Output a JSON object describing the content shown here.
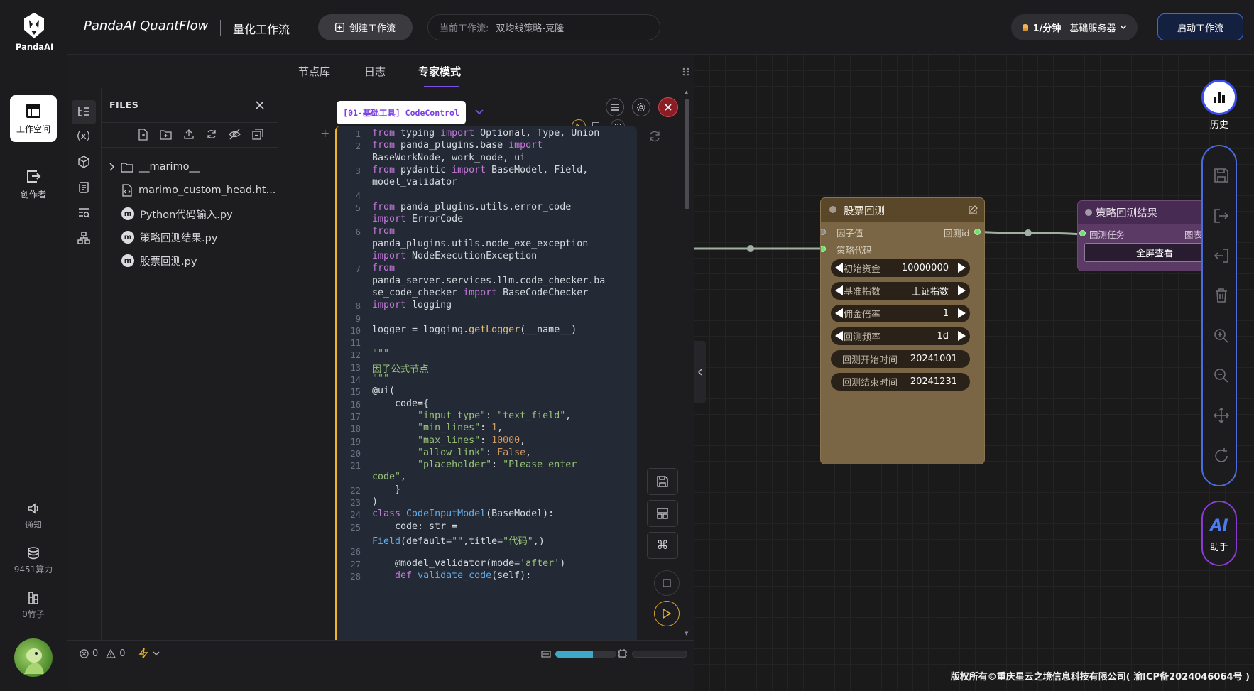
{
  "nav": {
    "logo_text": "PandaAI",
    "workspace": "工作空间",
    "creator": "创作者",
    "notify": "通知",
    "compute": "9451算力",
    "bamboo": "0竹子"
  },
  "top": {
    "app_title": "PandaAI QuantFlow",
    "subtitle": "量化工作流",
    "create_btn": "创建工作流",
    "current_label": "当前工作流:",
    "current_value": "双均线策略-克隆",
    "server_rate": "1/分钟",
    "server_name": "基础服务器",
    "start_btn": "启动工作流"
  },
  "tabs": [
    "节点库",
    "日志",
    "专家模式"
  ],
  "files": {
    "title": "FILES",
    "items": [
      "__marimo__",
      "marimo_custom_head.ht...",
      "Python代码输入.py",
      "策略回测结果.py",
      "股票回测.py"
    ]
  },
  "cell_tag": "[01-基础工具] CodeControl",
  "code": [
    {
      "n": "1",
      "h": "<span class='kw'>from</span> typing <span class='kw'>import</span> Optional, Type, Union"
    },
    {
      "n": "2",
      "h": "<span class='kw'>from</span> panda_plugins.base <span class='kw'>import</span>"
    },
    {
      "n": "",
      "h": "BaseWorkNode, work_node, ui"
    },
    {
      "n": "3",
      "h": "<span class='kw'>from</span> pydantic <span class='kw'>import</span> BaseModel, Field,"
    },
    {
      "n": "",
      "h": "model_validator"
    },
    {
      "n": "4",
      "h": ""
    },
    {
      "n": "5",
      "h": "<span class='kw'>from</span> panda_plugins.utils.error_code"
    },
    {
      "n": "",
      "h": "<span class='kw'>import</span> ErrorCode"
    },
    {
      "n": "6",
      "h": "<span class='kw'>from</span>"
    },
    {
      "n": "",
      "h": "panda_plugins.utils.node_exe_exception"
    },
    {
      "n": "",
      "h": "<span class='kw'>import</span> NodeExecutionException"
    },
    {
      "n": "7",
      "h": "<span class='kw'>from</span>"
    },
    {
      "n": "",
      "h": "panda_server.services.llm.code_checker.ba"
    },
    {
      "n": "",
      "h": "se_code_checker <span class='kw'>import</span> BaseCodeChecker"
    },
    {
      "n": "8",
      "h": "<span class='kw'>import</span> logging"
    },
    {
      "n": "9",
      "h": ""
    },
    {
      "n": "10",
      "h": "logger = logging.<span class='cn'>getLogger</span>(__name__)"
    },
    {
      "n": "11",
      "h": ""
    },
    {
      "n": "12",
      "h": "<span class='st'>\"\"\"</span>"
    },
    {
      "n": "13",
      "h": "<span class='st'>因子公式节点</span>"
    },
    {
      "n": "14",
      "h": "<span class='st'>\"\"\"</span>"
    },
    {
      "n": "15",
      "h": "@ui("
    },
    {
      "n": "16",
      "h": "    code={"
    },
    {
      "n": "17",
      "h": "        <span class='st'>\"input_type\"</span>: <span class='st'>\"text_field\"</span>,"
    },
    {
      "n": "18",
      "h": "        <span class='st'>\"min_lines\"</span>: <span class='nm'>1</span>,"
    },
    {
      "n": "19",
      "h": "        <span class='st'>\"max_lines\"</span>: <span class='nm'>10000</span>,"
    },
    {
      "n": "20",
      "h": "        <span class='st'>\"allow_link\"</span>: <span class='nm'>False</span>,"
    },
    {
      "n": "21",
      "h": "        <span class='st'>\"placeholder\"</span>: <span class='st'>\"Please enter</span>"
    },
    {
      "n": "",
      "h": "<span class='st'>code\"</span>,"
    },
    {
      "n": "22",
      "h": "    }"
    },
    {
      "n": "23",
      "h": ")"
    },
    {
      "n": "24",
      "h": "<span class='kw'>class</span> <span class='fn'>CodeInputModel</span>(BaseModel):"
    },
    {
      "n": "25",
      "h": "    code: str ="
    },
    {
      "n": "",
      "h": "<span class='fn'>Field</span>(default=<span class='st'>\"\"</span>,title=<span class='st'>\"代码\"</span>,)"
    },
    {
      "n": "26",
      "h": ""
    },
    {
      "n": "27",
      "h": "    @model_validator(mode=<span class='st'>'after'</span>)"
    },
    {
      "n": "28",
      "h": "    <span class='kw'>def</span> <span class='fn'>validate_code</span>(self):"
    }
  ],
  "status": {
    "errors": "0",
    "warnings": "0"
  },
  "node_backtest": {
    "title": "股票回测",
    "port_in_1": "因子值",
    "port_in_2": "策略代码",
    "port_out": "回测id",
    "fields": [
      {
        "label": "初始资金",
        "value": "10000000"
      },
      {
        "label": "基准指数",
        "value": "上证指数"
      },
      {
        "label": "佣金倍率",
        "value": "1"
      },
      {
        "label": "回测频率",
        "value": "1d"
      }
    ],
    "dates": [
      {
        "label": "回测开始时间",
        "value": "20241001"
      },
      {
        "label": "回测结束时间",
        "value": "20241231"
      }
    ]
  },
  "node_result": {
    "title": "策略回测结果",
    "port_in": "回测任务",
    "port_out": "图表",
    "button": "全屏查看"
  },
  "right": {
    "history": "历史",
    "ai": "AI",
    "ai_label": "助手"
  },
  "footer": "版权所有©重庆星云之境信息科技有限公司( 渝ICP备2024046064号 )"
}
